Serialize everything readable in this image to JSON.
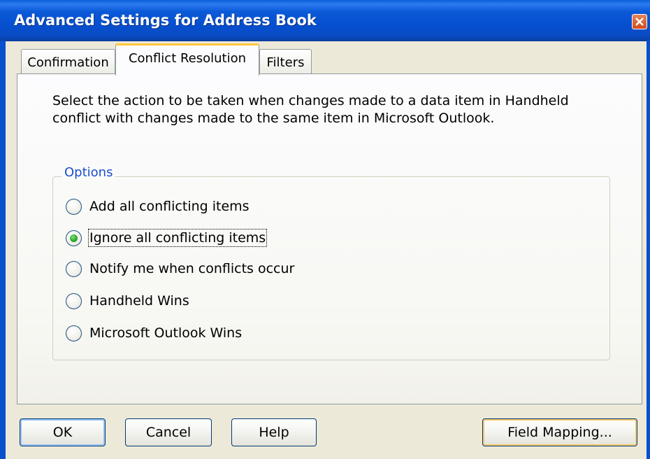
{
  "window": {
    "title": "Advanced Settings for Address Book"
  },
  "tabs": [
    {
      "label": "Confirmation",
      "selected": false
    },
    {
      "label": "Conflict Resolution",
      "selected": true
    },
    {
      "label": "Filters",
      "selected": false
    }
  ],
  "panel": {
    "description": "Select the action to be taken when changes made to a data item in Handheld conflict with changes made to the same item in Microsoft Outlook.",
    "group_label": "Options",
    "options": [
      {
        "label": "Add all conflicting items",
        "checked": false
      },
      {
        "label": "Ignore all conflicting items",
        "checked": true
      },
      {
        "label": "Notify me when conflicts occur",
        "checked": false
      },
      {
        "label": "Handheld Wins",
        "checked": false
      },
      {
        "label": "Microsoft Outlook Wins",
        "checked": false
      }
    ]
  },
  "buttons": {
    "ok": "OK",
    "cancel": "Cancel",
    "help": "Help",
    "field_mapping": "Field Mapping..."
  },
  "colors": {
    "titlebar": "#0a50cc",
    "window_bg": "#ece9d8",
    "group_label": "#1a4fd0",
    "selected_tab_accent": "#ffc83c"
  },
  "icons": {
    "close": "close-icon",
    "radio": "radio-button-icon"
  }
}
